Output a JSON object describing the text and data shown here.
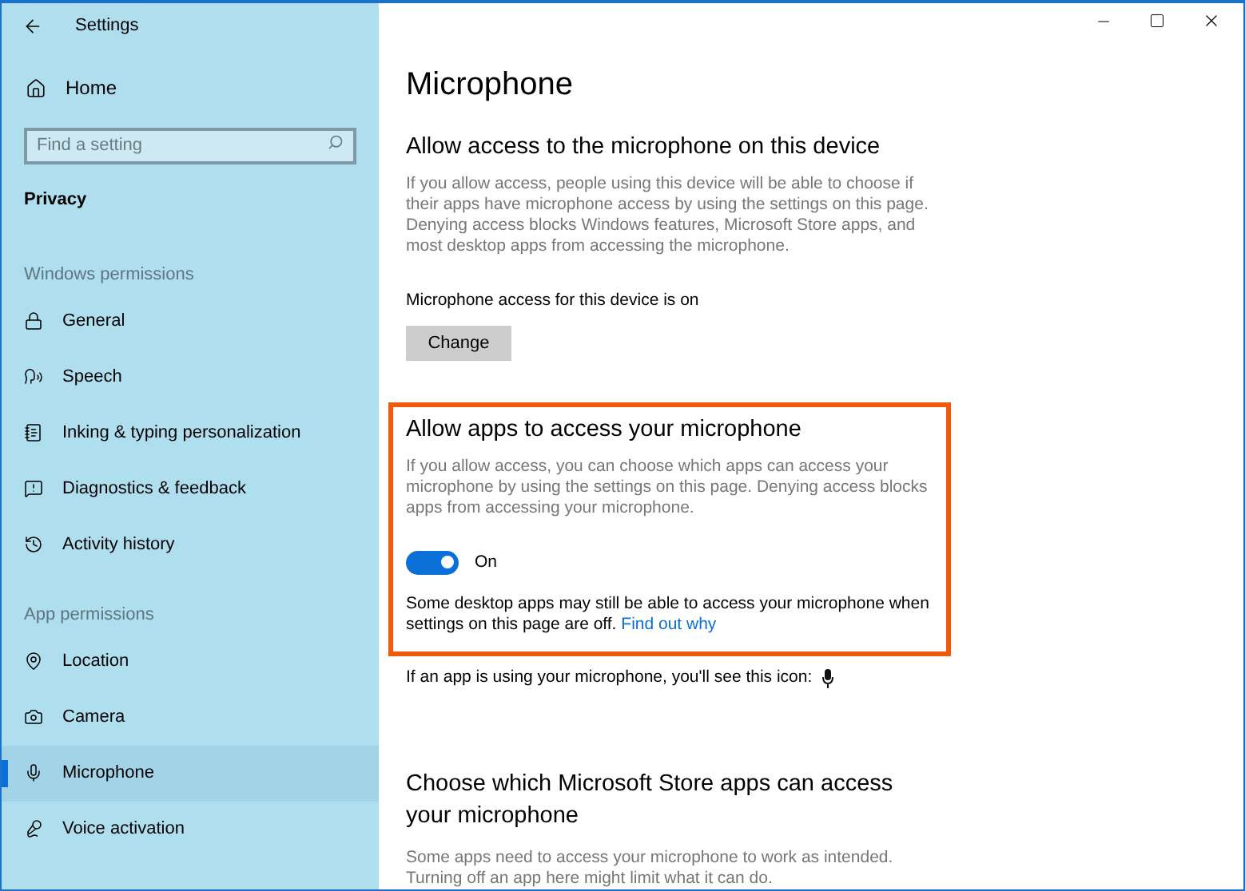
{
  "window": {
    "title": "Settings"
  },
  "sidebar": {
    "home": "Home",
    "search": {
      "placeholder": "Find a setting"
    },
    "category": "Privacy",
    "groups": [
      {
        "heading": "Windows permissions",
        "items": [
          {
            "label": "General",
            "kind": "lock",
            "selected": false
          },
          {
            "label": "Speech",
            "kind": "speech",
            "selected": false
          },
          {
            "label": "Inking & typing personalization",
            "kind": "notebook",
            "selected": false
          },
          {
            "label": "Diagnostics & feedback",
            "kind": "feedback",
            "selected": false
          },
          {
            "label": "Activity history",
            "kind": "history",
            "selected": false
          }
        ]
      },
      {
        "heading": "App permissions",
        "items": [
          {
            "label": "Location",
            "kind": "location",
            "selected": false
          },
          {
            "label": "Camera",
            "kind": "camera",
            "selected": false
          },
          {
            "label": "Microphone",
            "kind": "mic",
            "selected": true
          },
          {
            "label": "Voice activation",
            "kind": "voice",
            "selected": false
          }
        ]
      }
    ]
  },
  "main": {
    "title": "Microphone",
    "sections": [
      {
        "heading": "Allow access to the microphone on this device",
        "description": "If you allow access, people using this device will be able to choose if their apps have microphone access by using the settings on this page. Denying access blocks Windows features, Microsoft Store apps, and most desktop apps from accessing the microphone.",
        "status": "Microphone access for this device is on",
        "button": "Change",
        "highlighted": false
      },
      {
        "heading": "Allow apps to access your microphone",
        "description": "If you allow access, you can choose which apps can access your microphone by using the settings on this page. Denying access blocks apps from accessing your microphone.",
        "toggle": {
          "on": true,
          "label": "On"
        },
        "note": "Some desktop apps may still be able to access your microphone when settings on this page are off.",
        "link": "Find out why",
        "highlighted": true
      }
    ],
    "icon_hint": "If an app is using your microphone, you'll see this icon:",
    "store_section": {
      "heading": "Choose which Microsoft Store apps can access your microphone",
      "description": "Some apps need to access your microphone to work as intended. Turning off an app here might limit what it can do."
    }
  }
}
